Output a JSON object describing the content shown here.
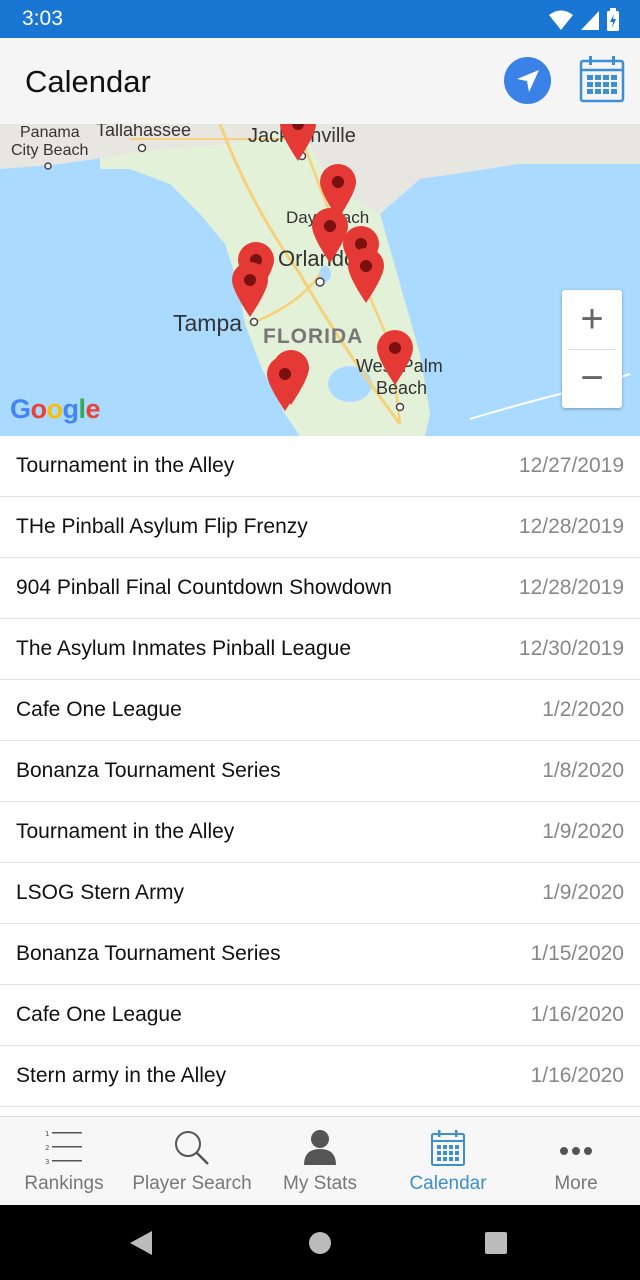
{
  "status": {
    "time": "3:03"
  },
  "header": {
    "title": "Calendar"
  },
  "map": {
    "labels": {
      "panama": "Panama",
      "city_beach": "City Beach",
      "tallahassee": "Tallahassee",
      "jacksonville": "Jacksonville",
      "daytona": "Day Beach",
      "orlando": "Orlando",
      "tampa": "Tampa",
      "florida": "FLORIDA",
      "west_palm": "West Palm",
      "beach": "Beach"
    },
    "zoom_in": "+",
    "zoom_out": "−",
    "google": "Google"
  },
  "events": [
    {
      "name": "Tournament in the Alley",
      "date": "12/27/2019"
    },
    {
      "name": "THe Pinball Asylum Flip Frenzy",
      "date": "12/28/2019"
    },
    {
      "name": "904 Pinball Final Countdown Showdown",
      "date": "12/28/2019"
    },
    {
      "name": "The Asylum Inmates Pinball League",
      "date": "12/30/2019"
    },
    {
      "name": "Cafe One League",
      "date": "1/2/2020"
    },
    {
      "name": "Bonanza Tournament Series",
      "date": "1/8/2020"
    },
    {
      "name": "Tournament in the Alley",
      "date": "1/9/2020"
    },
    {
      "name": "LSOG Stern Army",
      "date": "1/9/2020"
    },
    {
      "name": "Bonanza Tournament Series",
      "date": "1/15/2020"
    },
    {
      "name": "Cafe One League",
      "date": "1/16/2020"
    },
    {
      "name": "Stern army in the Alley",
      "date": "1/16/2020"
    }
  ],
  "tabs": [
    {
      "label": "Rankings",
      "icon": "list-icon"
    },
    {
      "label": "Player Search",
      "icon": "search-icon"
    },
    {
      "label": "My Stats",
      "icon": "person-icon"
    },
    {
      "label": "Calendar",
      "icon": "calendar-icon",
      "active": true
    },
    {
      "label": "More",
      "icon": "more-icon"
    }
  ],
  "colors": {
    "accent": "#3d8fd1",
    "status_bar": "#1976d2",
    "pin": "#e53935"
  }
}
